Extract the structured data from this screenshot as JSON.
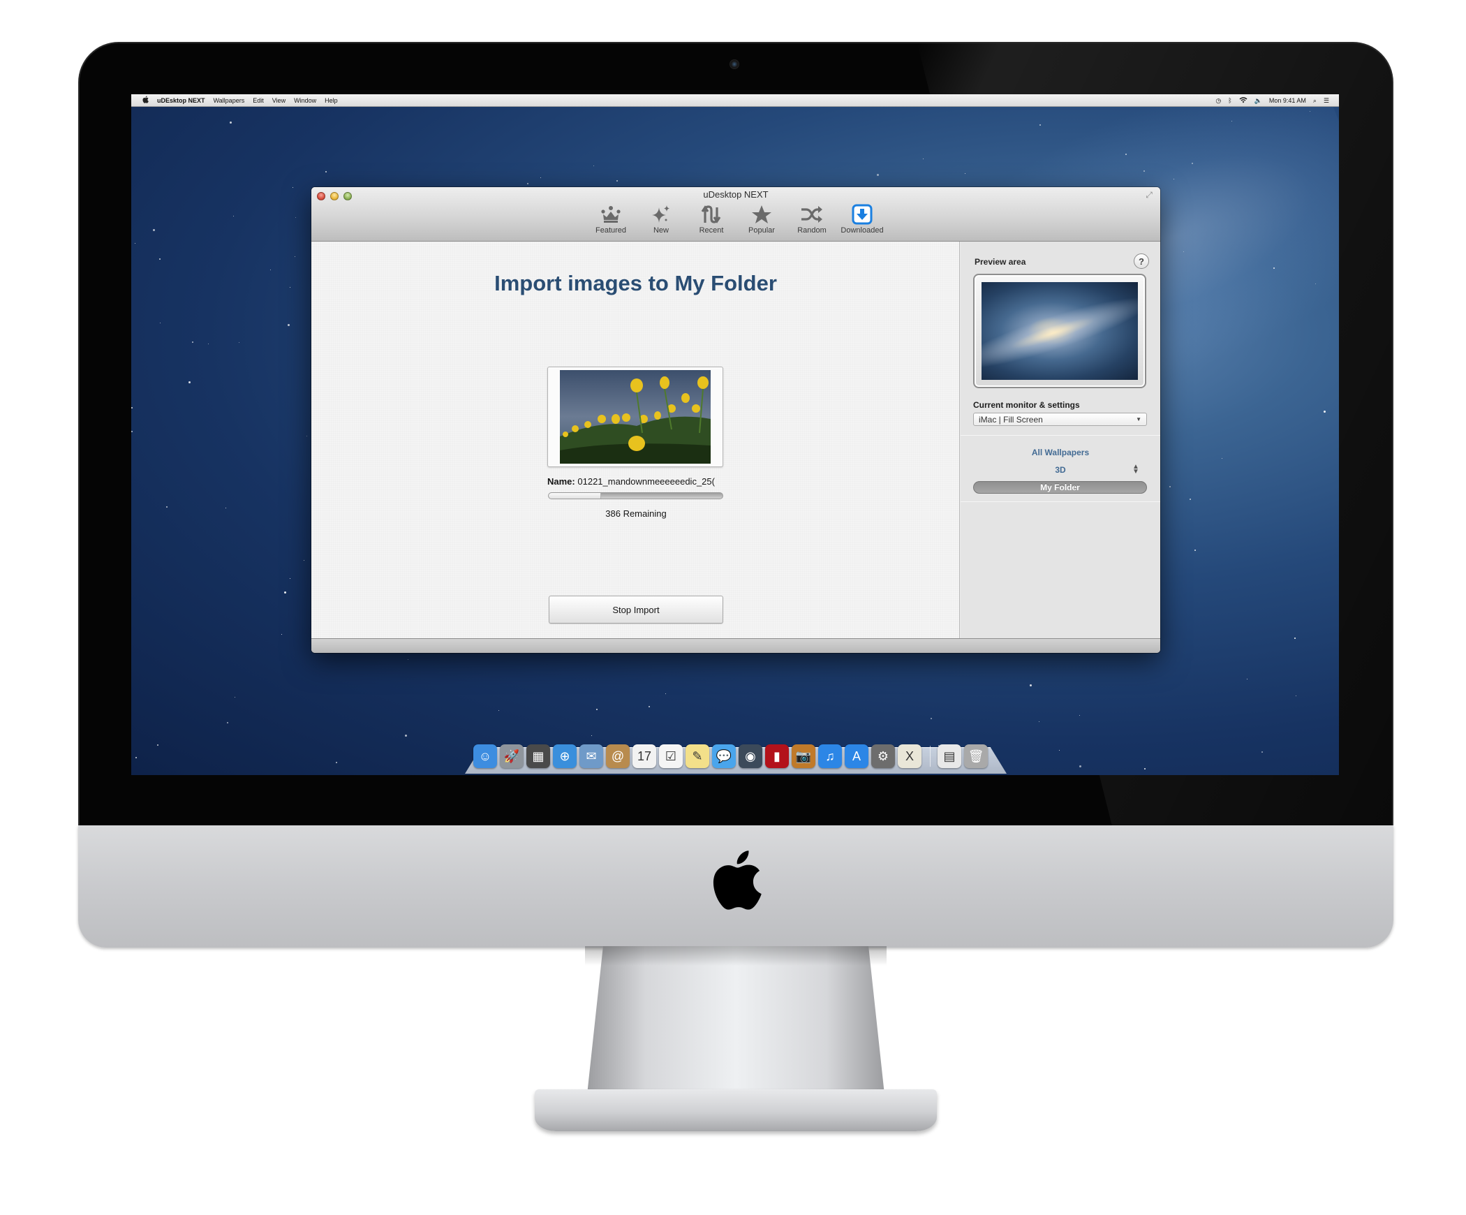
{
  "menubar": {
    "apple_icon": "apple-icon",
    "items": [
      "uDEsktop NEXT",
      "Wallpapers",
      "Edit",
      "View",
      "Window",
      "Help"
    ],
    "status": {
      "icons": [
        "time-machine-icon",
        "bluetooth-icon",
        "wifi-icon",
        "volume-icon"
      ],
      "clock": "Mon 9:41 AM",
      "spotlight_icon": "search-icon",
      "notifications_icon": "list-icon"
    }
  },
  "window": {
    "title": "uDesktop NEXT",
    "toolbar": [
      {
        "label": "Featured",
        "icon": "crown-icon"
      },
      {
        "label": "New",
        "icon": "sparkle-icon"
      },
      {
        "label": "Recent",
        "icon": "recent-arrows-icon"
      },
      {
        "label": "Popular",
        "icon": "star-icon"
      },
      {
        "label": "Random",
        "icon": "shuffle-icon"
      },
      {
        "label": "Downloaded",
        "icon": "download-icon",
        "active": true
      }
    ],
    "accent_color": "#1a7fe0"
  },
  "main": {
    "title": "Import images to My Folder",
    "file_name_label": "Name:",
    "file_name_value": "01221_mandownmeeeeeedic_25(",
    "progress": 0.3,
    "remaining_text": "386 Remaining",
    "stop_button": "Stop Import"
  },
  "sidebar": {
    "preview_label": "Preview area",
    "help_label": "?",
    "monitor_label": "Current monitor & settings",
    "monitor_value": "iMac | Fill Screen",
    "sources": {
      "all": "All Wallpapers",
      "category": "3D",
      "selected": "My Folder"
    }
  },
  "dock": {
    "apps": [
      {
        "name": "finder-icon",
        "glyph": "☺",
        "bg": "#3d8de0"
      },
      {
        "name": "launchpad-icon",
        "glyph": "🚀",
        "bg": "#8f959c"
      },
      {
        "name": "mission-control-icon",
        "glyph": "▦",
        "bg": "#4a4a4a"
      },
      {
        "name": "safari-icon",
        "glyph": "⊕",
        "bg": "#3a8fdc"
      },
      {
        "name": "mail-icon",
        "glyph": "✉",
        "bg": "#6f9ac8"
      },
      {
        "name": "contacts-icon",
        "glyph": "@",
        "bg": "#b88b4e"
      },
      {
        "name": "calendar-icon",
        "glyph": "17",
        "bg": "#f2f2f2"
      },
      {
        "name": "reminders-icon",
        "glyph": "☑",
        "bg": "#f5f5f5"
      },
      {
        "name": "notes-icon",
        "glyph": "✎",
        "bg": "#f3e08a"
      },
      {
        "name": "messages-icon",
        "glyph": "💬",
        "bg": "#4aa5ec"
      },
      {
        "name": "facetime-icon",
        "glyph": "◉",
        "bg": "#3c4a5a"
      },
      {
        "name": "photo-booth-icon",
        "glyph": "▮",
        "bg": "#b3121b"
      },
      {
        "name": "iphoto-icon",
        "glyph": "📷",
        "bg": "#c07a2a"
      },
      {
        "name": "itunes-icon",
        "glyph": "♫",
        "bg": "#2c86e6"
      },
      {
        "name": "app-store-icon",
        "glyph": "A",
        "bg": "#2c86e6"
      },
      {
        "name": "system-preferences-icon",
        "glyph": "⚙",
        "bg": "#6d6d6d"
      },
      {
        "name": "udesktop-icon",
        "glyph": "X",
        "bg": "#e9e6d8"
      }
    ],
    "stacks": [
      {
        "name": "documents-stack-icon",
        "glyph": "▤",
        "bg": "#e8e8e8"
      },
      {
        "name": "trash-icon",
        "glyph": "🗑",
        "bg": "#a9a9a9"
      }
    ]
  }
}
